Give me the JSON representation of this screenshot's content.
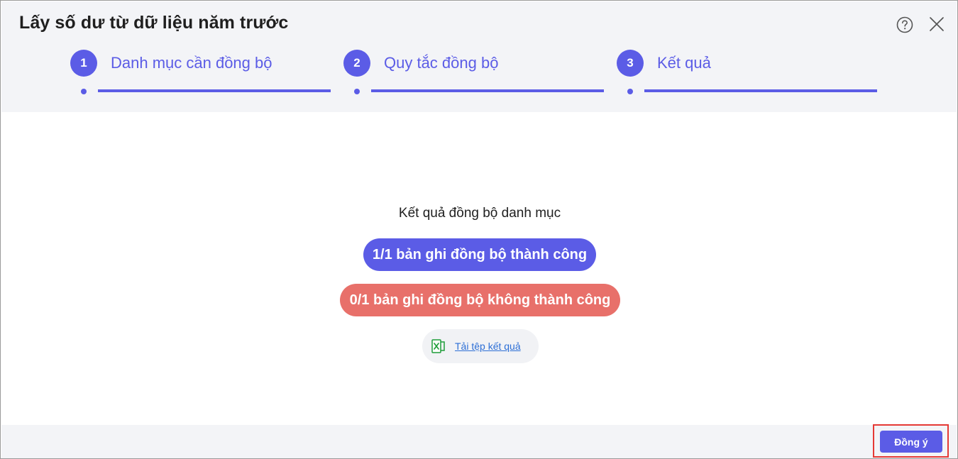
{
  "dialog": {
    "title": "Lấy số dư từ dữ liệu năm trước",
    "help_icon": "help-circle-icon",
    "close_icon": "close-icon"
  },
  "steps": [
    {
      "number": "1",
      "label": "Danh mục cần đồng bộ"
    },
    {
      "number": "2",
      "label": "Quy tắc đồng bộ"
    },
    {
      "number": "3",
      "label": "Kết quả"
    }
  ],
  "result": {
    "heading": "Kết quả đồng bộ danh mục",
    "success_text": "1/1 bản ghi đồng bộ thành công",
    "fail_text": "0/1 bản ghi đồng bộ không thành công",
    "download_text": "Tải tệp kết quả",
    "download_icon": "excel-file-icon"
  },
  "footer": {
    "ok_label": "Đồng ý"
  },
  "colors": {
    "accent": "#5b5ce6",
    "fail": "#e8706a",
    "link": "#2d6fd6",
    "excel": "#1f9d3a"
  }
}
